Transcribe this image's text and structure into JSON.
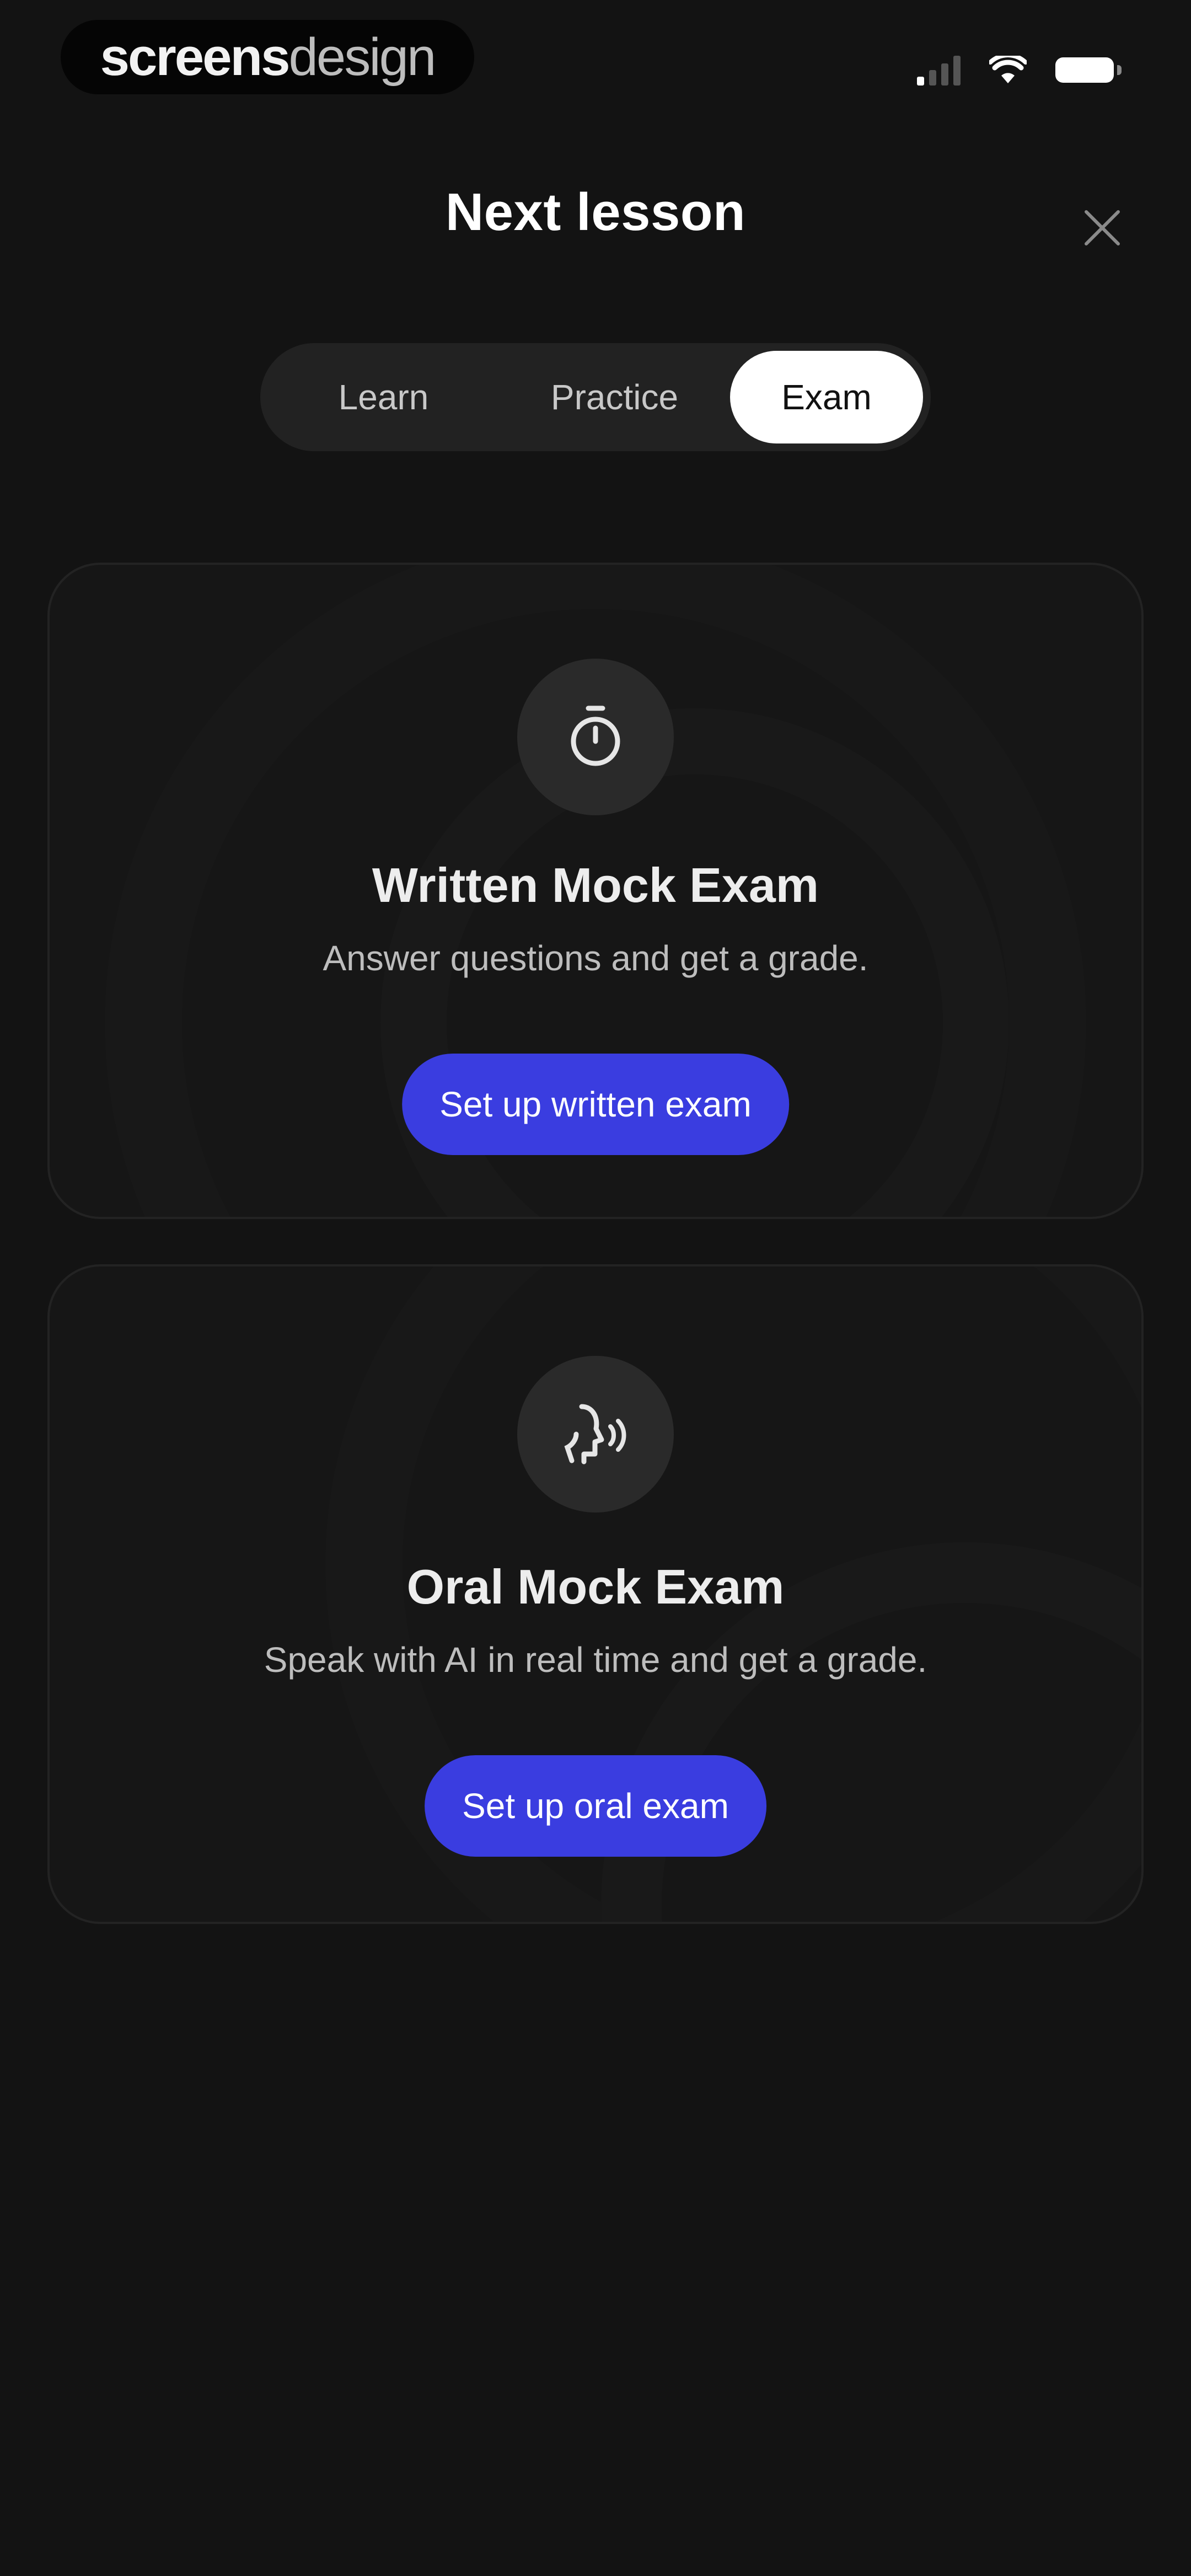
{
  "status_bar": {
    "watermark_part1": "screens",
    "watermark_part2": "design",
    "icons": [
      "signal-icon",
      "wifi-icon",
      "battery-icon"
    ]
  },
  "header": {
    "title": "Next lesson",
    "close_icon": "close-icon"
  },
  "tabs": [
    {
      "label": "Learn",
      "active": false
    },
    {
      "label": "Practice",
      "active": false
    },
    {
      "label": "Exam",
      "active": true
    }
  ],
  "cards": [
    {
      "icon": "stopwatch-icon",
      "title": "Written Mock Exam",
      "description": "Answer questions and get a grade.",
      "button_label": "Set up written exam"
    },
    {
      "icon": "speaking-head-icon",
      "title": "Oral Mock Exam",
      "description": "Speak with AI in real time and get a grade.",
      "button_label": "Set up oral exam"
    }
  ],
  "colors": {
    "background": "#131313",
    "card_background": "#161616",
    "accent": "#3a3de0",
    "active_tab": "#ffffff"
  }
}
